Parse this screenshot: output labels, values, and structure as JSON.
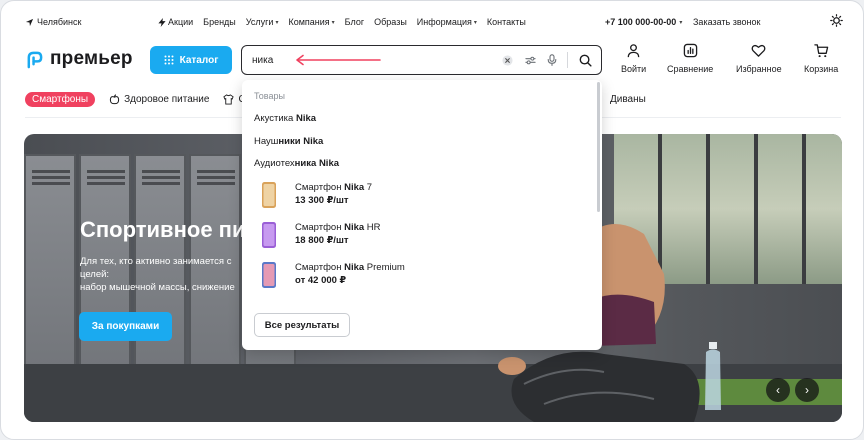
{
  "topbar": {
    "city": "Челябинск",
    "nav": [
      {
        "label": "Акции",
        "caret": false,
        "icon": true
      },
      {
        "label": "Бренды",
        "caret": false
      },
      {
        "label": "Услуги",
        "caret": true
      },
      {
        "label": "Компания",
        "caret": true
      },
      {
        "label": "Блог",
        "caret": false
      },
      {
        "label": "Образы",
        "caret": false
      },
      {
        "label": "Информация",
        "caret": true
      },
      {
        "label": "Контакты",
        "caret": false
      }
    ],
    "phone": "+7 100 000-00-00",
    "phone_caret": "▾",
    "callback": "Заказать звонок"
  },
  "header": {
    "logo_text": "премьер",
    "catalog_label": "Каталог",
    "search": {
      "value": "ника",
      "placeholder": ""
    },
    "icons": [
      {
        "name": "login",
        "label": "Войти"
      },
      {
        "name": "compare",
        "label": "Сравнение"
      },
      {
        "name": "favorites",
        "label": "Избранное"
      },
      {
        "name": "cart",
        "label": "Корзина"
      }
    ]
  },
  "categories": {
    "active": "Смартфоны",
    "items": [
      "Здоровое питание",
      "С"
    ],
    "right_visible": "Диваны"
  },
  "hero": {
    "title": "Спортивное пи",
    "text_lines": [
      "Для тех, кто активно занимается с",
      "целей:",
      "набор мышечной массы, снижение"
    ],
    "button": "За покупками",
    "prev": "‹",
    "next": "›"
  },
  "dropdown": {
    "section_title": "Товары",
    "suggestions": [
      {
        "pre": "Акустика ",
        "bold": "Nika",
        "post": ""
      },
      {
        "pre": "Науш",
        "bold": "ники",
        "post": "",
        "tail_pre": " ",
        "tail_bold": "Nika"
      },
      {
        "pre": "Аудиотех",
        "bold": "ника",
        "post": "",
        "tail_pre": " ",
        "tail_bold": "Nika"
      }
    ],
    "products": [
      {
        "pre": "Смартфон ",
        "bold": "Nika",
        "post": " 7",
        "price": "13 300 ₽/шт",
        "color": "#d9a25a"
      },
      {
        "pre": "Смартфон ",
        "bold": "Nika",
        "post": " HR",
        "price": "18 800 ₽/шт",
        "color": "#9a5fd6"
      },
      {
        "pre": "Смартфон ",
        "bold": "Nika",
        "post": " Premium",
        "price": "от 42 000 ₽",
        "color": "#d46a8a"
      }
    ],
    "all_results": "Все результаты"
  },
  "colors": {
    "accent": "#1aaaf0",
    "chip": "#f0415f",
    "search_arrow": "#f0415f"
  }
}
